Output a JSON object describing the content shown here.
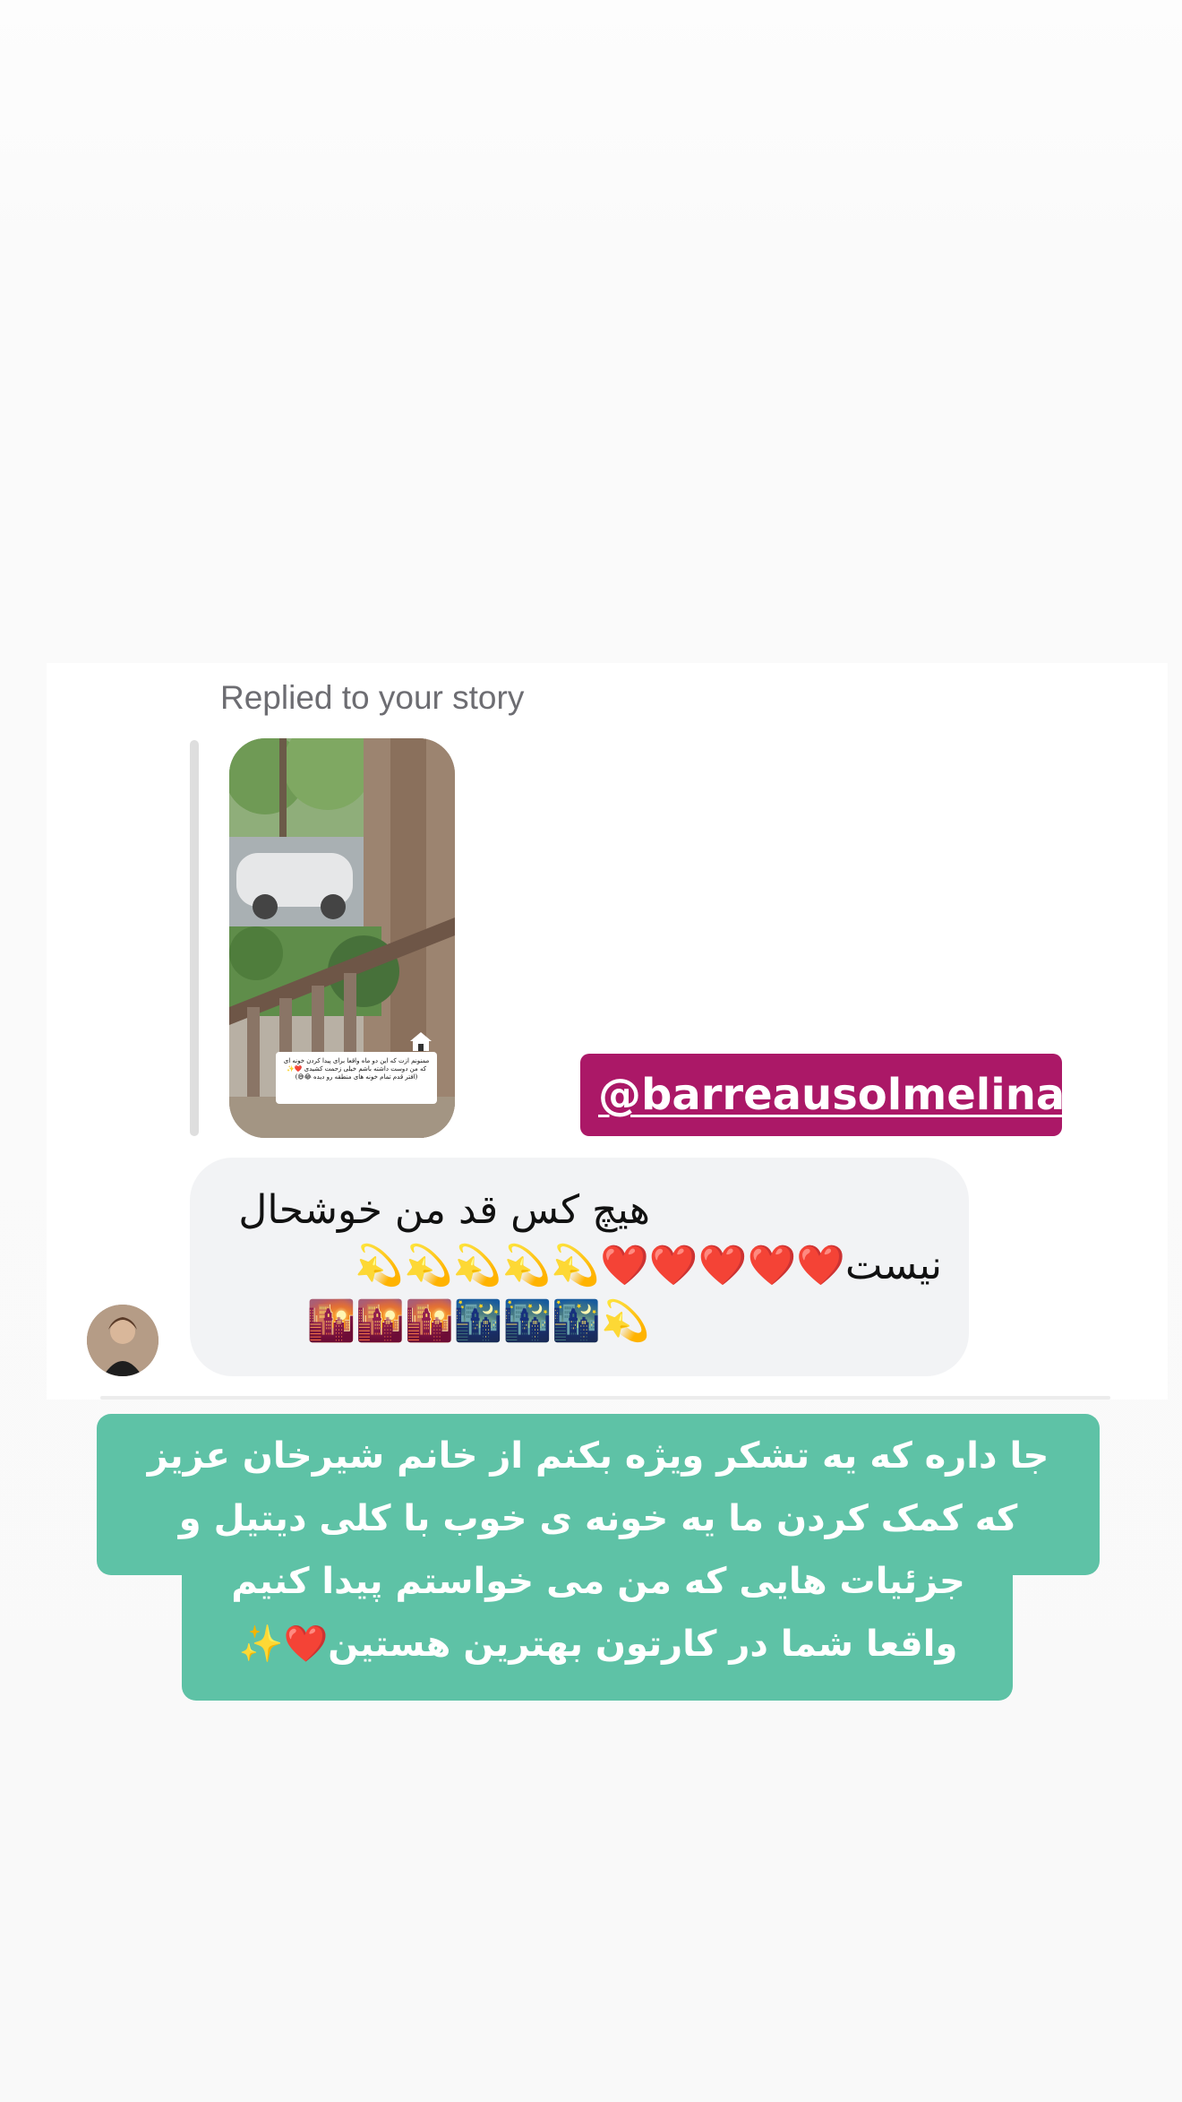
{
  "reply": {
    "label": "Replied to your story",
    "story_caption": "ممنونم ازت که این دو ماه واقعا برای پیدا کردن خونه ای که من دوست داشته باشم خیلی زحمت کشیدی ❤️✨ (افتر قدم تمام خونه های منطقه رو دیده 😂😅)",
    "mention": "@barreausolmelina"
  },
  "message": {
    "line1": "هیچ کس قد من خوشحال",
    "line2": "نیست❤️❤️❤️❤️❤️💫💫💫💫💫",
    "line3": "💫🌃🌃🌃🌇🌇🌇"
  },
  "story_text": {
    "line1": "جا داره که یه تشکر ویژه بکنم از خانم شیرخان عزیز",
    "line2": "که کمک کردن ما یه خونه ی خوب با کلی دیتیل و",
    "line3": "جزئیات هایی که من می خواستم پیدا کنیم",
    "line4": "واقعا شما در کارتون بهترین هستین❤️✨"
  },
  "colors": {
    "mention_bg": "#ab1867",
    "sticker_bg": "#5ec2a6",
    "bubble_bg": "#f2f3f5"
  }
}
